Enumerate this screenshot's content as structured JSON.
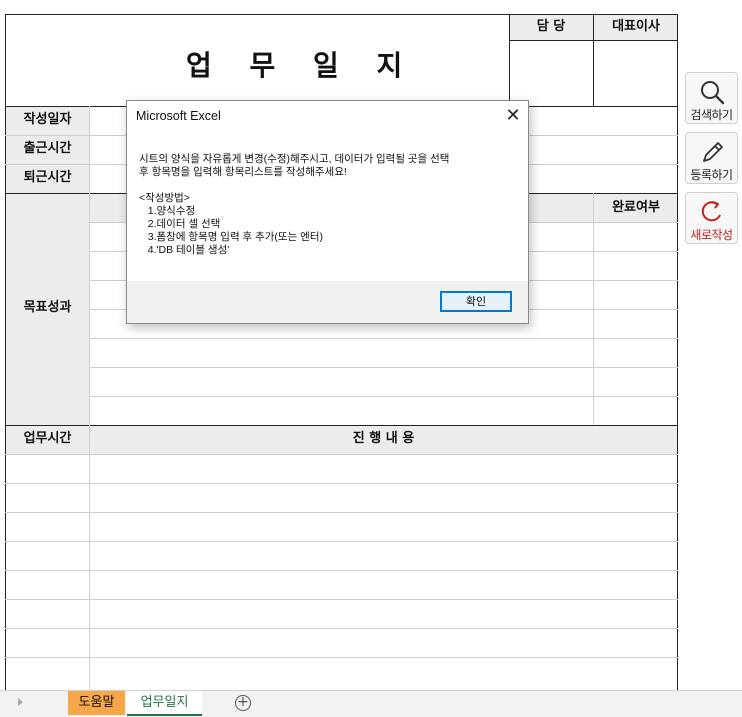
{
  "form": {
    "title": "업 무 일 지",
    "approval": {
      "manager": "담 당",
      "ceo": "대표이사"
    },
    "labels": {
      "date": "작성일자",
      "start_time": "출근시간",
      "end_time": "퇴근시간",
      "goals": "목표성과",
      "completion": "완료여부",
      "work_time": "업무시간",
      "progress": "진 행 내 용"
    }
  },
  "side_buttons": [
    {
      "label": "검색하기",
      "icon": "search-icon"
    },
    {
      "label": "등록하기",
      "icon": "pencil-icon"
    },
    {
      "label": "새로작성",
      "icon": "refresh-icon",
      "color": "#c0221b"
    }
  ],
  "dialog": {
    "title": "Microsoft Excel",
    "message": "시트의 양식을 자유롭게 변경(수정)해주시고, 데이터가 입력될 곳을 선택\n후 항목명을 입력해 항목리스트를 작성해주세요!\n\n<작성방법>\n   1.양식수정\n   2.데이터 셀 선택\n   3.폼창에 항목명 입력 후 추가(또는 엔터)\n   4.'DB 테이블 생성'",
    "ok_label": "확인"
  },
  "tabs": {
    "help": "도움말",
    "journal": "업무일지",
    "help_color": "#f7a64a",
    "active_color": "#217346"
  }
}
